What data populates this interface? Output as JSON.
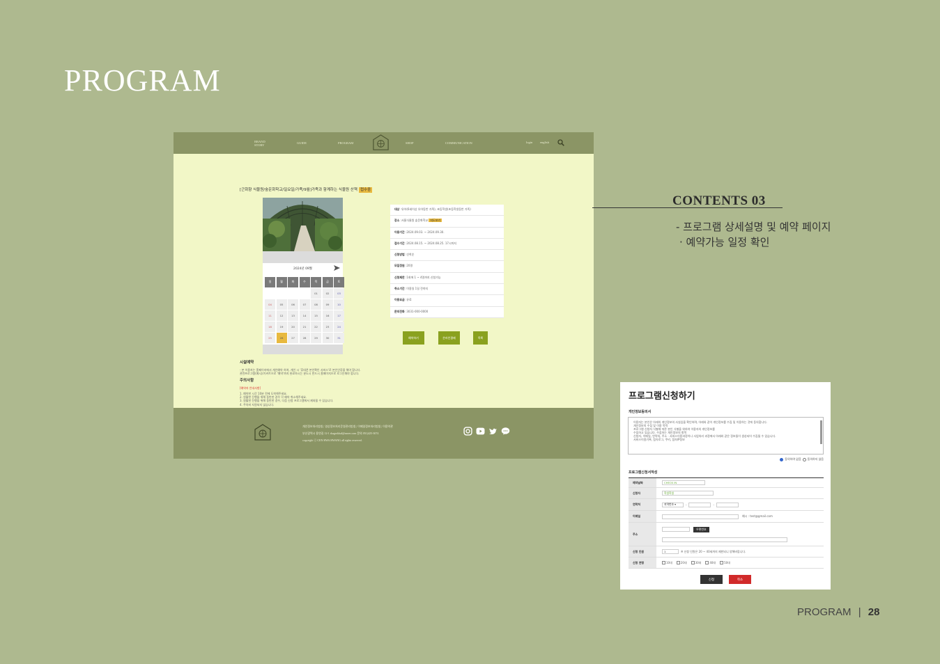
{
  "page_title": "PROGRAM",
  "site": {
    "nav": [
      "BRAND STORY",
      "GUIDE",
      "PROGRAM",
      "SHOP",
      "COMMUNICATION"
    ],
    "nav_right": [
      "login",
      "english"
    ],
    "logo_text": "CEN HWA HWANG",
    "program_title": "[근화향 식물원/숲운화학교/일요일/가족/9월]가족과 함께하는 식물원 산책",
    "status": "접수중",
    "calendar": {
      "month": "2024년 09월",
      "weekdays": [
        "일",
        "월",
        "화",
        "수",
        "목",
        "금",
        "토"
      ],
      "days": [
        "",
        "",
        "",
        "",
        "01",
        "02",
        "03",
        "04",
        "05",
        "06",
        "07",
        "08",
        "09",
        "10",
        "11",
        "12",
        "13",
        "14",
        "15",
        "16",
        "17",
        "18",
        "19",
        "20",
        "21",
        "22",
        "23",
        "24",
        "25",
        "26",
        "27",
        "28",
        "29",
        "30",
        "31"
      ],
      "selected": "26"
    },
    "info": [
      {
        "label": "대상",
        "value": ":유아(6세이상 유아동반 가족), 초등학생(초등학생동반 가족)"
      },
      {
        "label": "장소",
        "value": ":서울식물원 숲운화학교",
        "link": "지도보기"
      },
      {
        "label": "이용기간",
        "value": ":2024.09.03. ~ 2024.09.30."
      },
      {
        "label": "접수기간",
        "value": ":2024.08.15. ~ 2024.08.25. 17시까지"
      },
      {
        "label": "신청방법",
        "value": ":선착순"
      },
      {
        "label": "모집정원",
        "value": ":20명"
      },
      {
        "label": "신청제한",
        "value": ":1회에 1 ~ 4명까지 신청가능"
      },
      {
        "label": "취소기간",
        "value": ":이용일 1일 전까지"
      },
      {
        "label": "이용요금",
        "value": ":유료"
      },
      {
        "label": "문의전화",
        "value": ":3031-000-0000"
      }
    ],
    "buttons": [
      "예약하기",
      "온라인결제",
      "목록"
    ],
    "notice": {
      "heading": "시설예약",
      "lines": [
        "- 본 이용자는 홈페이지에서 개인예약 하여, 개인 시 '휴대폰 본인확인 서비스'로 본인인증을 해야 합니다.",
        "  관련프로그램(예시)/기커트으로 '예약'까지 완료하시는 분도시 반드시 홈페이지으로 로그인해야 합니다."
      ],
      "heading2": "주의사항",
      "sub": "[예약자 안내사항]",
      "rules": [
        "1. 예약한 시간 10분 전에 도착해주세요.",
        "2. 원활한 진행을 위해 동반한 경우 각 예약 취소해주세요.",
        "3. 원활한 진행을 위해 동반한 경우, 다음 신청 프로그램에서 제외될 수 있습니다.",
        "4. 주차비 지원되지 않습니다."
      ]
    },
    "footer": {
      "links": "개인정보처리방침  |  영상정보처리운영관리방침  |  이메일정보처리방침  |  이용약관",
      "address": "부산광역시 용연길 12-1 rkagrokhal@naver.com 문의 051)425-3074",
      "copyright": "copyright ⓒ CEN HWA HWANG all rights reserved."
    }
  },
  "contents": {
    "title": "CONTENTS 03",
    "desc1": "- 프로그램 상세설명 및 예약 페이지",
    "desc2": "· 예약가능 일정 확인"
  },
  "form": {
    "title": "프로그램신청하기",
    "privacy_label": "개인정보동의서",
    "privacy_text": [
      "이용자는 본인은 아래의 개인정보의 사실임을 확인하며, 아래와 같이 개인정보를 수집 및 이용하는 것에 동의합니다.",
      "개인정보의 수집 및 이용 목적",
      "프로그램 신청자 식별에 따른 본인 식별을 위하여 이용자의 개인정보를",
      "수집하고 있습니다. 수집하는 개인정보의 항목",
      "신청자, 이메일, 연락처, 주소 · 서비스이용과정이나 사업처리 과정에서 아래와 같은 정보들이 생성되어 수집될 수 있습니다.",
      "서비스이용기록, 접속로그, 쿠키, 접속IP정보"
    ],
    "agree": "동의하지 않음",
    "agree_on": "동의하지 않음",
    "agree_yes": "동의하여 없음",
    "section_label": "프로그램신청서작성",
    "rows": {
      "date_label": "예약날짜",
      "date_value": "CHECK IN",
      "name_label": "신청자",
      "name_value": "학생학생",
      "phone_label": "연락처",
      "phone_select": "지역번호 ▾",
      "email_label": "이메일",
      "email_hint": "예시 : test@gmail.com",
      "addr_label": "주소",
      "addr_btn": "우편번호",
      "count_label": "신청 인원",
      "count_value": "1",
      "count_hint": "※ 신청 인원은 20 ~ 40세까지 제한되니 양해바랍니다.",
      "age_label": "신청 연령",
      "ages": [
        "10대",
        "20대",
        "30대",
        "40대",
        "50대"
      ]
    },
    "apply": "신청",
    "cancel": "취소"
  },
  "footer": {
    "label": "PROGRAM",
    "page": "28"
  }
}
